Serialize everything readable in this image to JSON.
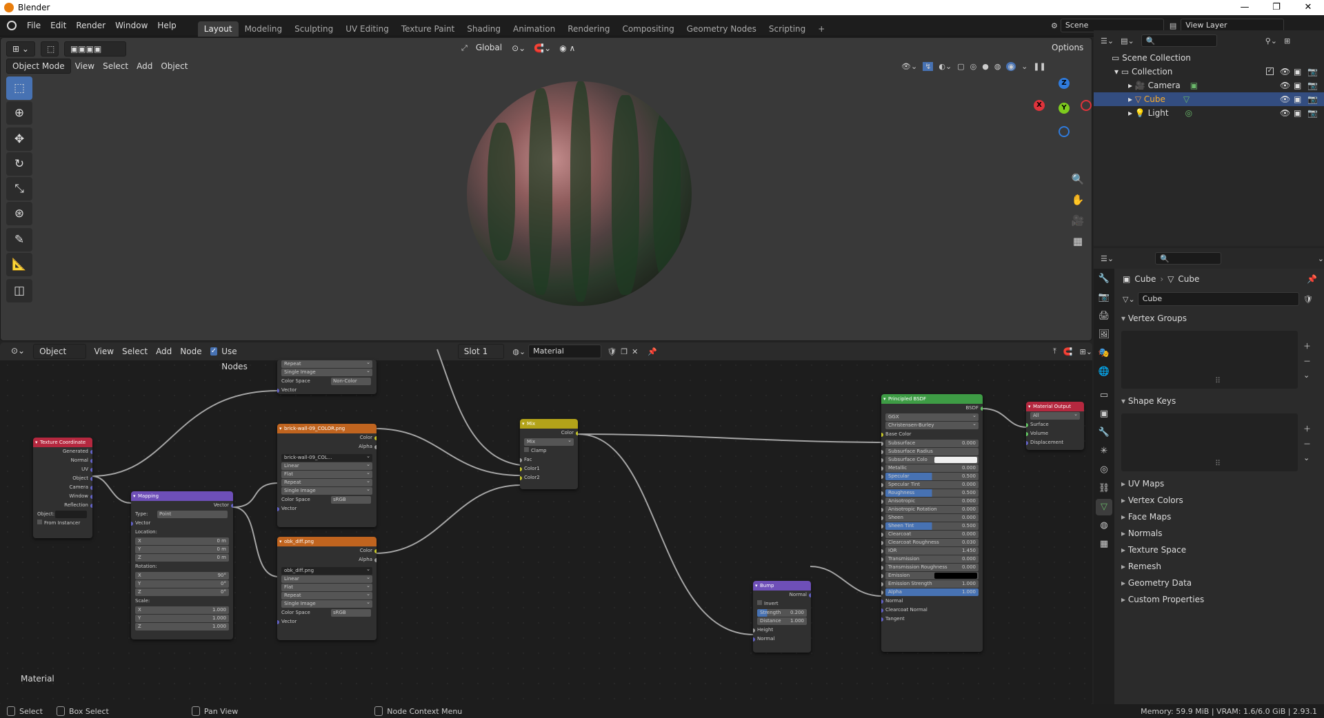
{
  "app": {
    "title": "Blender"
  },
  "menu": [
    "File",
    "Edit",
    "Render",
    "Window",
    "Help"
  ],
  "workspaces": [
    {
      "label": "Layout",
      "active": true
    },
    {
      "label": "Modeling"
    },
    {
      "label": "Sculpting"
    },
    {
      "label": "UV Editing"
    },
    {
      "label": "Texture Paint"
    },
    {
      "label": "Shading"
    },
    {
      "label": "Animation"
    },
    {
      "label": "Rendering"
    },
    {
      "label": "Compositing"
    },
    {
      "label": "Geometry Nodes"
    },
    {
      "label": "Scripting"
    }
  ],
  "scene": {
    "name": "Scene",
    "view_layer": "View Layer"
  },
  "viewport": {
    "mode": "Object Mode",
    "menus": [
      "View",
      "Select",
      "Add",
      "Object"
    ],
    "transform_orientation": "Global",
    "options_label": "Options",
    "gizmo": {
      "x": "X",
      "y": "Y",
      "z": "Z"
    }
  },
  "node_editor": {
    "type": "Object",
    "menus": [
      "View",
      "Select",
      "Add",
      "Node"
    ],
    "use_nodes_label": "Use Nodes",
    "slot": "Slot 1",
    "material": "Material",
    "tree_label": "Material"
  },
  "nodes": {
    "top_image": {
      "rows": [
        "Repeat",
        "Single Image"
      ],
      "color_space_label": "Color Space",
      "color_space": "Non-Color",
      "vector": "Vector"
    },
    "tex_coord": {
      "title": "Texture Coordinate",
      "outputs": [
        "Generated",
        "Normal",
        "UV",
        "Object",
        "Camera",
        "Window",
        "Reflection"
      ],
      "object_label": "Object:",
      "from_instancer": "From Instancer"
    },
    "mapping": {
      "title": "Mapping",
      "vector_out": "Vector",
      "type_label": "Type:",
      "type": "Point",
      "vector_in": "Vector",
      "location_label": "Location:",
      "location": [
        {
          "a": "X",
          "v": "0 m"
        },
        {
          "a": "Y",
          "v": "0 m"
        },
        {
          "a": "Z",
          "v": "0 m"
        }
      ],
      "rotation_label": "Rotation:",
      "rotation": [
        {
          "a": "X",
          "v": "90°"
        },
        {
          "a": "Y",
          "v": "0°"
        },
        {
          "a": "Z",
          "v": "0°"
        }
      ],
      "scale_label": "Scale:",
      "scale": [
        {
          "a": "X",
          "v": "1.000"
        },
        {
          "a": "Y",
          "v": "1.000"
        },
        {
          "a": "Z",
          "v": "1.000"
        }
      ]
    },
    "brick": {
      "title": "brick-wall-09_COLOR.png",
      "color": "Color",
      "alpha": "Alpha",
      "image": "brick-wall-09_COL...",
      "interp": "Linear",
      "proj": "Flat",
      "ext": "Repeat",
      "src": "Single Image",
      "color_space_label": "Color Space",
      "color_space": "sRGB",
      "vector": "Vector"
    },
    "obk": {
      "title": "obk_diff.png",
      "color": "Color",
      "alpha": "Alpha",
      "image": "obk_diff.png",
      "interp": "Linear",
      "proj": "Flat",
      "ext": "Repeat",
      "src": "Single Image",
      "color_space_label": "Color Space",
      "color_space": "sRGB",
      "vector": "Vector"
    },
    "mix": {
      "title": "Mix",
      "color": "Color",
      "blend": "Mix",
      "clamp": "Clamp",
      "fac": "Fac",
      "color1": "Color1",
      "color2": "Color2"
    },
    "bump": {
      "title": "Bump",
      "normal_out": "Normal",
      "invert": "Invert",
      "strength_label": "Strength",
      "strength": "0.200",
      "distance_label": "Distance",
      "distance": "1.000",
      "height": "Height",
      "normal_in": "Normal"
    },
    "bsdf": {
      "title": "Principled BSDF",
      "bsdf": "BSDF",
      "distribution": "GGX",
      "subsurface_method": "Christensen-Burley",
      "base_color": "Base Color",
      "fields": [
        {
          "l": "Subsurface",
          "v": "0.000"
        },
        {
          "l": "Subsurface Radius",
          "v": "",
          "dd": true
        },
        {
          "l": "Subsurface Colo",
          "v": "",
          "white": true
        },
        {
          "l": "Metallic",
          "v": "0.000"
        },
        {
          "l": "Specular",
          "v": "0.500",
          "blue": true
        },
        {
          "l": "Specular Tint",
          "v": "0.000"
        },
        {
          "l": "Roughness",
          "v": "0.500",
          "blue": true
        },
        {
          "l": "Anisotropic",
          "v": "0.000"
        },
        {
          "l": "Anisotropic Rotation",
          "v": "0.000"
        },
        {
          "l": "Sheen",
          "v": "0.000"
        },
        {
          "l": "Sheen Tint",
          "v": "0.500",
          "blue": true
        },
        {
          "l": "Clearcoat",
          "v": "0.000"
        },
        {
          "l": "Clearcoat Roughness",
          "v": "0.030"
        },
        {
          "l": "IOR",
          "v": "1.450"
        },
        {
          "l": "Transmission",
          "v": "0.000"
        },
        {
          "l": "Transmission Roughness",
          "v": "0.000"
        },
        {
          "l": "Emission",
          "v": "",
          "black": true
        },
        {
          "l": "Emission Strength",
          "v": "1.000"
        },
        {
          "l": "Alpha",
          "v": "1.000",
          "full": true
        }
      ],
      "inputs": [
        "Normal",
        "Clearcoat Normal",
        "Tangent"
      ]
    },
    "output": {
      "title": "Material Output",
      "target": "All",
      "inputs": [
        "Surface",
        "Volume",
        "Displacement"
      ]
    }
  },
  "outliner": {
    "root": "Scene Collection",
    "collection": "Collection",
    "items": [
      {
        "name": "Camera"
      },
      {
        "name": "Cube",
        "selected": true
      },
      {
        "name": "Light"
      }
    ]
  },
  "properties": {
    "breadcrumb_obj": "Cube",
    "breadcrumb_data": "Cube",
    "data_name": "Cube",
    "panels_open": [
      "Vertex Groups",
      "Shape Keys"
    ],
    "panels": [
      "UV Maps",
      "Vertex Colors",
      "Face Maps",
      "Normals",
      "Texture Space",
      "Remesh",
      "Geometry Data",
      "Custom Properties"
    ]
  },
  "status": {
    "select": "Select",
    "box_select": "Box Select",
    "pan_view": "Pan View",
    "context_menu": "Node Context Menu",
    "memory": "Memory: 59.9 MiB | VRAM: 1.6/6.0 GiB | 2.93.1"
  }
}
